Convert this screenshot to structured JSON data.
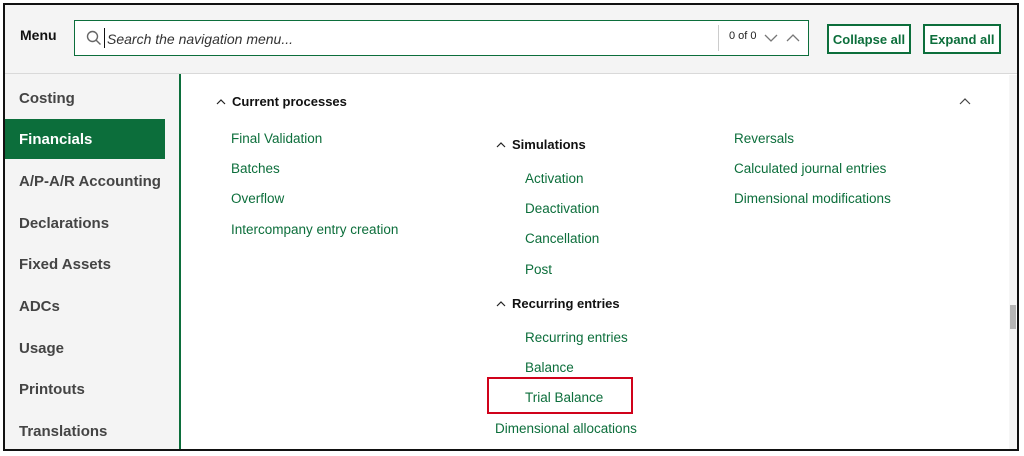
{
  "header": {
    "menu_label": "Menu",
    "search_placeholder": "Search the navigation menu...",
    "search_value": "",
    "counter": "0 of 0",
    "collapse_all": "Collapse all",
    "expand_all": "Expand all",
    "accent_color": "#0c6e3b"
  },
  "sidebar": {
    "items": [
      {
        "label": "Costing",
        "active": false
      },
      {
        "label": "Financials",
        "active": true
      },
      {
        "label": "A/P-A/R Accounting",
        "active": false
      },
      {
        "label": "Declarations",
        "active": false
      },
      {
        "label": "Fixed Assets",
        "active": false
      },
      {
        "label": "ADCs",
        "active": false
      },
      {
        "label": "Usage",
        "active": false
      },
      {
        "label": "Printouts",
        "active": false
      },
      {
        "label": "Translations",
        "active": false
      }
    ]
  },
  "main": {
    "section_title": "Current processes",
    "col1": [
      "Final Validation",
      "Batches",
      "Overflow",
      "Intercompany entry creation"
    ],
    "simulations": {
      "title": "Simulations",
      "items": [
        "Activation",
        "Deactivation",
        "Cancellation",
        "Post"
      ]
    },
    "recurring": {
      "title": "Recurring entries",
      "items": [
        "Recurring entries",
        "Balance",
        "Trial Balance"
      ]
    },
    "dimensional_allocations": "Dimensional allocations",
    "col3": [
      "Reversals",
      "Calculated journal entries",
      "Dimensional modifications"
    ],
    "highlight_color": "#d0021b"
  }
}
